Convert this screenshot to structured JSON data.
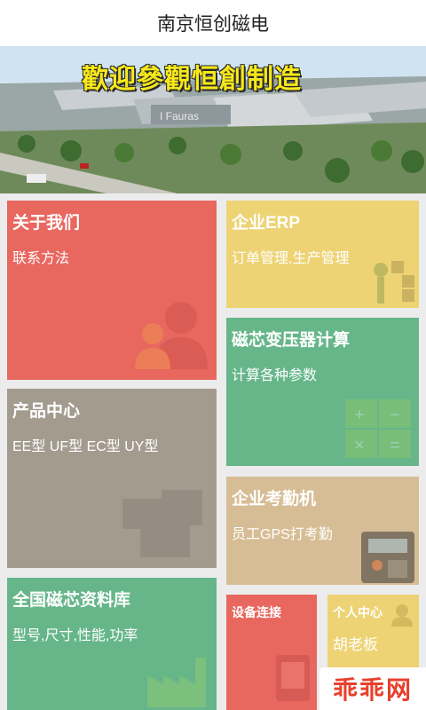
{
  "header": {
    "title": "南京恒创磁电"
  },
  "banner": {
    "headline": "歡迎參觀恒創制造",
    "sign": "I Fauras"
  },
  "tiles": [
    {
      "id": "about",
      "title": "关于我们",
      "subtitle": "联系方法",
      "color": "#e8675f",
      "icon": "user-icon"
    },
    {
      "id": "erp",
      "title": "企业ERP",
      "subtitle": "订单管理,生产管理",
      "color": "#edd374",
      "icon": "erp-icon"
    },
    {
      "id": "transformer",
      "title": "磁芯变压器计算",
      "subtitle": "计算各种参数",
      "color": "#66b68a",
      "icon": "calculator-icon"
    },
    {
      "id": "products",
      "title": "产品中心",
      "subtitle": "EE型 UF型 EC型 UY型",
      "color": "#a49b8f",
      "icon": "cores-icon"
    },
    {
      "id": "attendance",
      "title": "企业考勤机",
      "subtitle": "员工GPS打考勤",
      "color": "#d7bd95",
      "icon": "fingerprint-terminal-icon"
    },
    {
      "id": "library",
      "title": "全国磁芯资料库",
      "subtitle": "型号,尺寸,性能,功率",
      "color": "#66b68a",
      "icon": "factory-icon"
    },
    {
      "id": "device",
      "title": "设备连接",
      "subtitle": "",
      "color": "#e8675f",
      "icon": "device-icon"
    },
    {
      "id": "personal",
      "title": "个人中心",
      "subtitle": "胡老板",
      "color": "#edd374",
      "icon": "person-icon"
    }
  ],
  "watermark": {
    "text": "乖乖网"
  }
}
